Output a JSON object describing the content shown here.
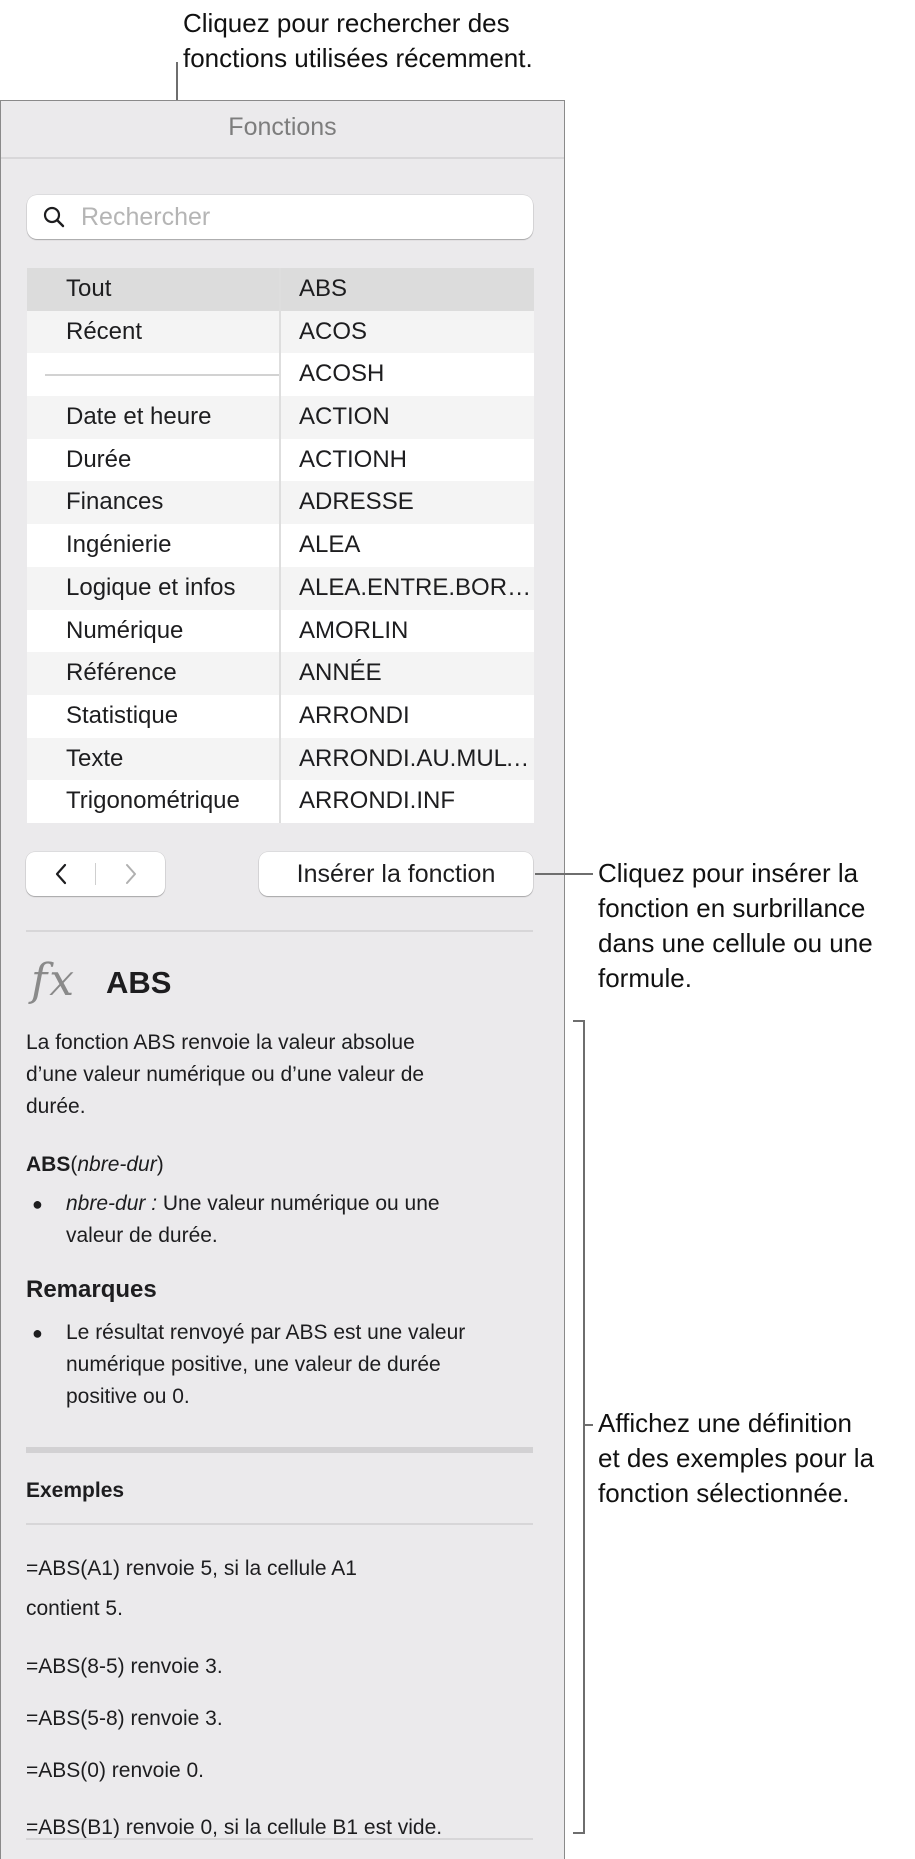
{
  "callouts": {
    "recent": [
      "Cliquez pour rechercher des",
      "fonctions utilisées récemment."
    ],
    "insert": [
      "Cliquez pour insérer la",
      "fonction en surbrillance",
      "dans une cellule ou une",
      "formule."
    ],
    "definition": [
      "Affichez une définition",
      "et des exemples pour la",
      "fonction sélectionnée."
    ]
  },
  "panel": {
    "title": "Fonctions",
    "search": {
      "placeholder": "Rechercher",
      "value": ""
    },
    "categories": [
      "Tout",
      "Récent",
      "",
      "Date et heure",
      "Durée",
      "Finances",
      "Ingénierie",
      "Logique et infos",
      "Numérique",
      "Référence",
      "Statistique",
      "Texte",
      "Trigonométrique"
    ],
    "functions": [
      "ABS",
      "ACOS",
      "ACOSH",
      "ACTION",
      "ACTIONH",
      "ADRESSE",
      "ALEA",
      "ALEA.ENTRE.BORNES",
      "AMORLIN",
      "ANNÉE",
      "ARRONDI",
      "ARRONDI.AU.MULTIPLE",
      "ARRONDI.INF"
    ],
    "selected_category": "Tout",
    "selected_function": "ABS",
    "nav": {
      "back_icon": "chevron-left-icon",
      "forward_icon": "chevron-right-icon"
    },
    "insert_label": "Insérer la fonction"
  },
  "detail": {
    "fx_icon": "fx",
    "name": "ABS",
    "description": [
      "La fonction ABS renvoie la valeur absolue",
      "d’une valeur numérique ou d’une valeur de",
      "durée."
    ],
    "syntax_name": "ABS",
    "syntax_arg": "nbre-dur",
    "arg_name": "nbre-dur :",
    "arg_desc": " Une valeur numérique ou une",
    "arg_desc2": "valeur de durée.",
    "remarks_title": "Remarques",
    "remarks": [
      "Le résultat renvoyé par ABS est une valeur",
      "numérique positive, une valeur de durée",
      "positive ou 0."
    ],
    "examples_title": "Exemples",
    "examples": [
      [
        "=ABS(A1) renvoie 5, si la cellule A1",
        "contient 5."
      ],
      [
        "=ABS(8-5) renvoie 3."
      ],
      [
        "=ABS(5-8) renvoie 3."
      ],
      [
        "=ABS(0) renvoie 0."
      ],
      [
        "=ABS(B1) renvoie 0, si la cellule B1 est vide."
      ]
    ]
  }
}
